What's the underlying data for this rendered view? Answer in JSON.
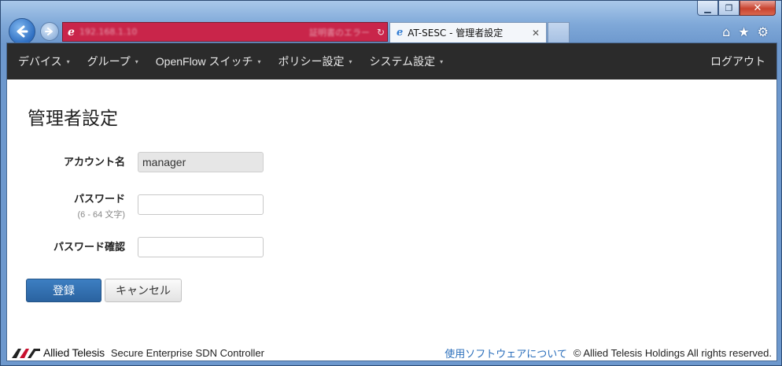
{
  "browser": {
    "tab_title": "AT-SESC - 管理者設定",
    "address_text": "192.168.1.10",
    "cert_text": "証明書のエラー",
    "colors": {
      "address_bg": "#c9254a",
      "frame": "#7fa8d8"
    }
  },
  "nav": {
    "items": [
      {
        "label": "デバイス"
      },
      {
        "label": "グループ"
      },
      {
        "label": "OpenFlow スイッチ"
      },
      {
        "label": "ポリシー設定"
      },
      {
        "label": "システム設定"
      }
    ],
    "logout": "ログアウト"
  },
  "page": {
    "title": "管理者設定"
  },
  "form": {
    "account_label": "アカウント名",
    "account_value": "manager",
    "password_label": "パスワード",
    "password_hint": "(6 - 64 文字)",
    "password_value": "",
    "confirm_label": "パスワード確認",
    "confirm_value": ""
  },
  "buttons": {
    "register": "登録",
    "cancel": "キャンセル"
  },
  "footer": {
    "logo_text": "Allied Telesis",
    "product": "Secure Enterprise SDN Controller",
    "about": "使用ソフトウェアについて",
    "copyright": "© Allied Telesis Holdings All rights reserved."
  }
}
